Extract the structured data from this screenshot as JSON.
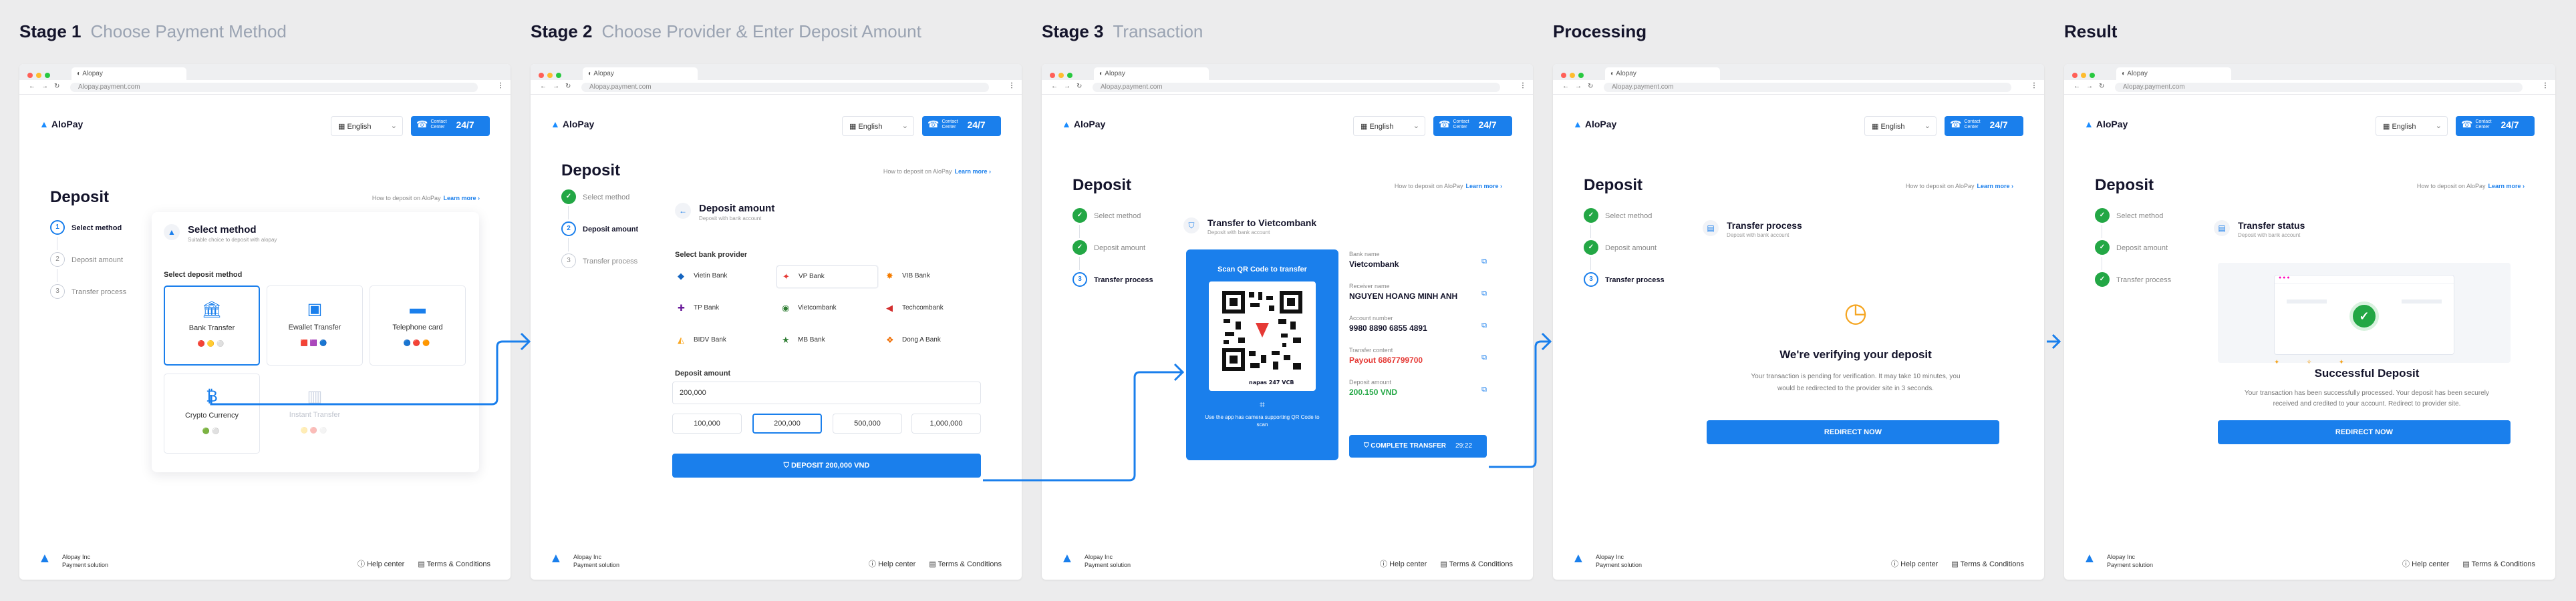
{
  "brand": {
    "name": "AloPay",
    "url": "Alopay.payment.com",
    "tab_title": "Alopay",
    "accent": "#1a7fec"
  },
  "header": {
    "language": "English",
    "contact_label": "Contact Center",
    "contact_hours": "24/7"
  },
  "common": {
    "deposit_title": "Deposit",
    "how_to": "How to deposit on AloPay",
    "learn_more": "Learn more ›",
    "footer_company": "Alopay Inc",
    "footer_tag": "Payment solution",
    "help_center": "Help center",
    "terms": "Terms & Conditions"
  },
  "stages": [
    {
      "title": "Stage 1",
      "subtitle": "Choose Payment Method"
    },
    {
      "title": "Stage 2",
      "subtitle": "Choose Provider & Enter Deposit Amount"
    },
    {
      "title": "Stage 3",
      "subtitle": "Transaction"
    },
    {
      "title": "Processing",
      "subtitle": ""
    },
    {
      "title": "Result",
      "subtitle": ""
    }
  ],
  "steps": [
    "Select method",
    "Deposit amount",
    "Transfer process"
  ],
  "stage1": {
    "card_title": "Select method",
    "card_sub": "Suitable choice to deposit with alopay",
    "section_label": "Select deposit method",
    "methods": [
      "Bank Transfer",
      "Ewallet Transfer",
      "Telephone card",
      "Crypto Currency",
      "Instant Transfer"
    ]
  },
  "stage2": {
    "card_title": "Deposit amount",
    "card_sub": "Deposit with bank account",
    "provider_label": "Select bank provider",
    "banks": [
      "Vietin Bank",
      "VP Bank",
      "VIB Bank",
      "TP Bank",
      "Vietcombank",
      "Techcombank",
      "BIDV Bank",
      "MB Bank",
      "Dong A Bank"
    ],
    "amount_label": "Deposit amount",
    "amount_value": "200,000",
    "quick_amounts": [
      "100,000",
      "200,000",
      "500,000",
      "1,000,000"
    ],
    "cta": "DEPOSIT 200,000 VND"
  },
  "stage3": {
    "card_title": "Transfer to Vietcombank",
    "card_sub": "Deposit with bank account",
    "qr_title": "Scan QR Code to transfer",
    "qr_caption": "Use the app has camera supporting QR Code to scan",
    "qr_brands": "napas 247   VCB",
    "fields": [
      {
        "label": "Bank name",
        "value": "Vietcombank"
      },
      {
        "label": "Receiver name",
        "value": "NGUYEN HOANG MINH ANH"
      },
      {
        "label": "Account number",
        "value": "9980 8890 6855 4891"
      },
      {
        "label": "Transfer content",
        "value": "Payout 6867799700"
      },
      {
        "label": "Deposit amount",
        "value": "200.150 VND"
      }
    ],
    "cta": "COMPLETE TRANSFER",
    "timer": "29:22"
  },
  "processing": {
    "card_title": "Transfer process",
    "card_sub": "Deposit with bank account",
    "heading": "We're verifying your deposit",
    "message": "Your transaction is pending for verification. It may take 10 minutes, you would be redirected to the provider site in 3 seconds.",
    "cta": "REDIRECT NOW"
  },
  "result": {
    "card_title": "Transfer status",
    "card_sub": "Deposit with bank account",
    "heading": "Successful Deposit",
    "message": "Your transaction has been successfully processed. Your deposit has been securely received and credited to your account. Redirect to provider site.",
    "cta": "REDIRECT NOW"
  }
}
